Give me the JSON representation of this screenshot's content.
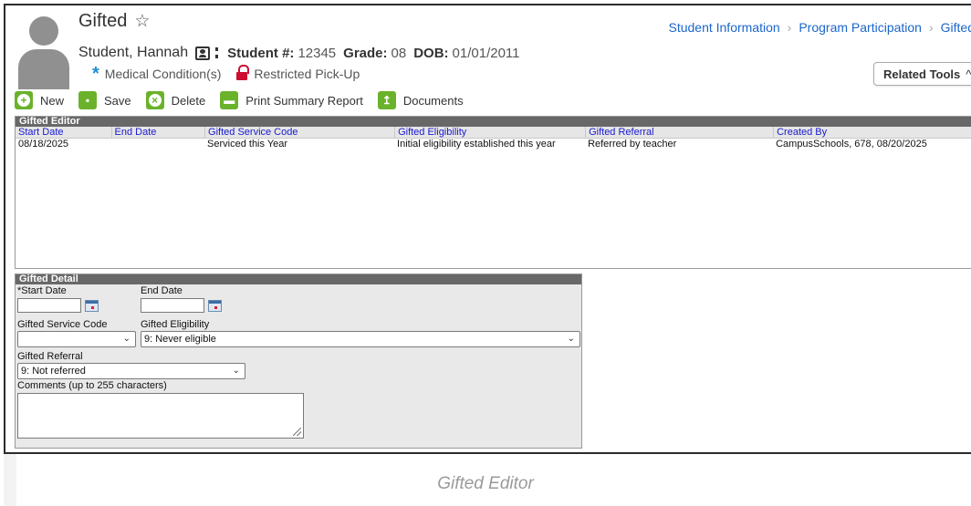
{
  "header": {
    "title": "Gifted",
    "student_name": "Student, Hannah",
    "student_num_label": "Student #:",
    "student_num": "12345",
    "grade_label": "Grade:",
    "grade": "08",
    "dob_label": "DOB:",
    "dob": "01/01/2011",
    "flags": [
      "Medical Condition(s)",
      "Restricted Pick-Up"
    ],
    "related_tools": "Related Tools"
  },
  "breadcrumb": [
    "Student Information",
    "Program Participation",
    "Gifted"
  ],
  "toolbar": {
    "new": "New",
    "save": "Save",
    "delete": "Delete",
    "print": "Print Summary Report",
    "documents": "Documents"
  },
  "editor": {
    "title": "Gifted Editor",
    "columns": [
      "Start Date",
      "End Date",
      "Gifted Service Code",
      "Gifted Eligibility",
      "Gifted Referral",
      "Created By"
    ],
    "rows": [
      [
        "08/18/2025",
        "",
        "Serviced this Year",
        "Initial eligibility established this year",
        "Referred by teacher",
        "CampusSchools, 678, 08/20/2025"
      ]
    ]
  },
  "detail": {
    "title": "Gifted Detail",
    "start_date_label": "*Start Date",
    "end_date_label": "End Date",
    "service_code_label": "Gifted Service Code",
    "service_code_value": "",
    "eligibility_label": "Gifted Eligibility",
    "eligibility_value": "9: Never eligible",
    "referral_label": "Gifted Referral",
    "referral_value": "9: Not referred",
    "comments_label": "Comments (up to 255 characters)"
  },
  "caption": "Gifted Editor",
  "colors": {
    "accent_green": "#6ab22b",
    "link_blue": "#1b66c9",
    "header_blue": "#1a1ad0",
    "panel_gray": "#686868",
    "alert_red": "#cc0d2f"
  }
}
